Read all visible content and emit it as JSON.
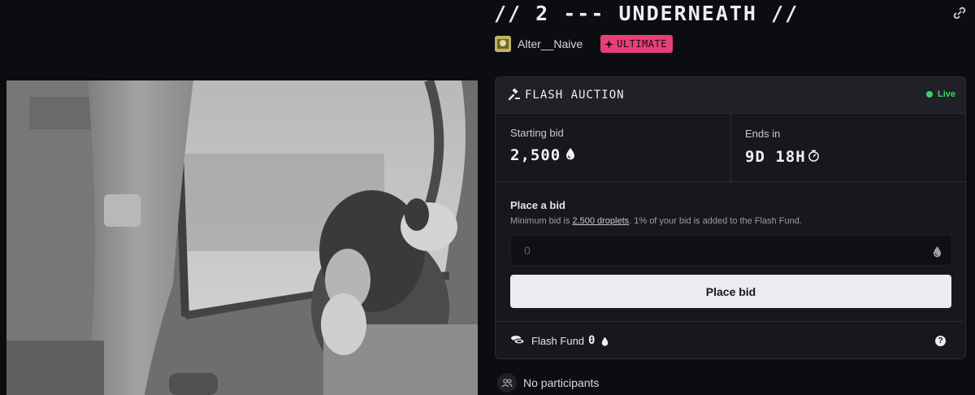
{
  "artwork": {
    "alt_icon": "photo-artwork"
  },
  "title": "// 2 --- UNDERNEATH //",
  "author": {
    "name": "Alter__Naive"
  },
  "tier_badge": {
    "label": "ULTIMATE",
    "color": "#e83f78"
  },
  "auction": {
    "type_label": "FLASH AUCTION",
    "status": "Live",
    "status_color": "#3fcf6a",
    "starting_bid_label": "Starting bid",
    "starting_bid_value": "2,500",
    "ends_in_label": "Ends in",
    "ends_in_value": "9D 18H",
    "bid": {
      "title": "Place a bid",
      "help_prefix": "Minimum bid is ",
      "help_link": "2,500 droplets",
      "help_suffix": ". 1% of your bid is added to the Flash Fund.",
      "input_placeholder": "0",
      "button_label": "Place bid"
    },
    "flash_fund": {
      "label": "Flash Fund",
      "value": "0",
      "help": "?"
    }
  },
  "participants": {
    "text": "No participants"
  }
}
